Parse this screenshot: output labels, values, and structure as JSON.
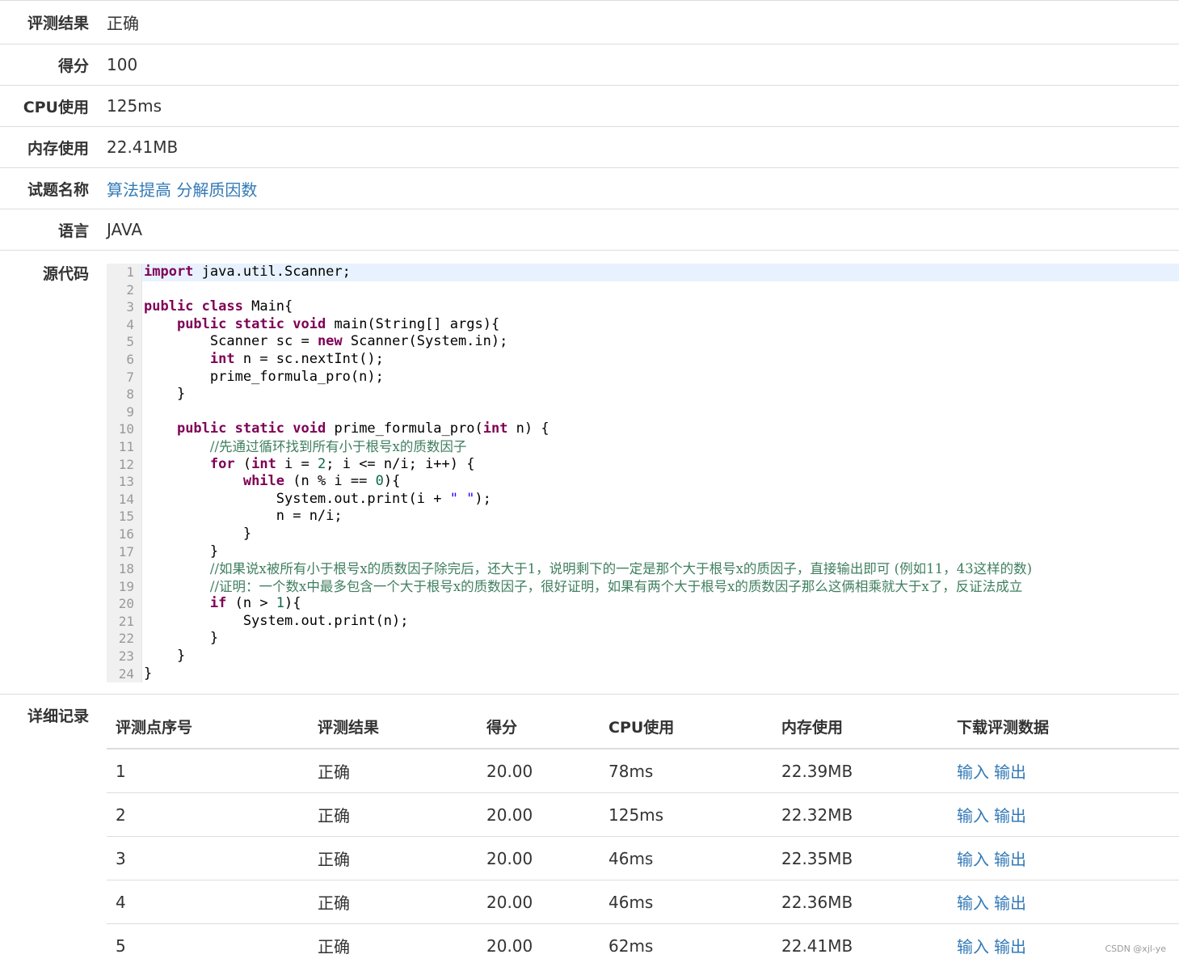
{
  "info": [
    {
      "label": "评测结果",
      "value": "正确"
    },
    {
      "label": "得分",
      "value": "100"
    },
    {
      "label": "CPU使用",
      "value": "125ms"
    },
    {
      "label": "内存使用",
      "value": "22.41MB"
    },
    {
      "label": "试题名称",
      "value": "算法提高 分解质因数"
    },
    {
      "label": "语言",
      "value": "JAVA"
    }
  ],
  "source": {
    "label": "源代码",
    "line_numbers": [
      "1",
      "2",
      "3",
      "4",
      "5",
      "6",
      "7",
      "8",
      "9",
      "10",
      "11",
      "12",
      "13",
      "14",
      "15",
      "16",
      "17",
      "18",
      "19",
      "20",
      "21",
      "22",
      "23",
      "24"
    ]
  },
  "details": {
    "label": "详细记录",
    "headers": [
      "评测点序号",
      "评测结果",
      "得分",
      "CPU使用",
      "内存使用",
      "下载评测数据"
    ],
    "rows": [
      {
        "id": "1",
        "result": "正确",
        "score": "20.00",
        "cpu": "78ms",
        "mem": "22.39MB",
        "input": "输入",
        "output": "输出"
      },
      {
        "id": "2",
        "result": "正确",
        "score": "20.00",
        "cpu": "125ms",
        "mem": "22.32MB",
        "input": "输入",
        "output": "输出"
      },
      {
        "id": "3",
        "result": "正确",
        "score": "20.00",
        "cpu": "46ms",
        "mem": "22.35MB",
        "input": "输入",
        "output": "输出"
      },
      {
        "id": "4",
        "result": "正确",
        "score": "20.00",
        "cpu": "46ms",
        "mem": "22.36MB",
        "input": "输入",
        "output": "输出"
      },
      {
        "id": "5",
        "result": "正确",
        "score": "20.00",
        "cpu": "62ms",
        "mem": "22.41MB",
        "input": "输入",
        "output": "输出"
      }
    ]
  },
  "watermark": "CSDN @xjl-ye",
  "colors": {
    "link": "#337ab7",
    "border": "#dddddd",
    "highlight_line": "#e8f2fe",
    "keyword": "#7f0055",
    "comment": "#3f7f5f"
  }
}
